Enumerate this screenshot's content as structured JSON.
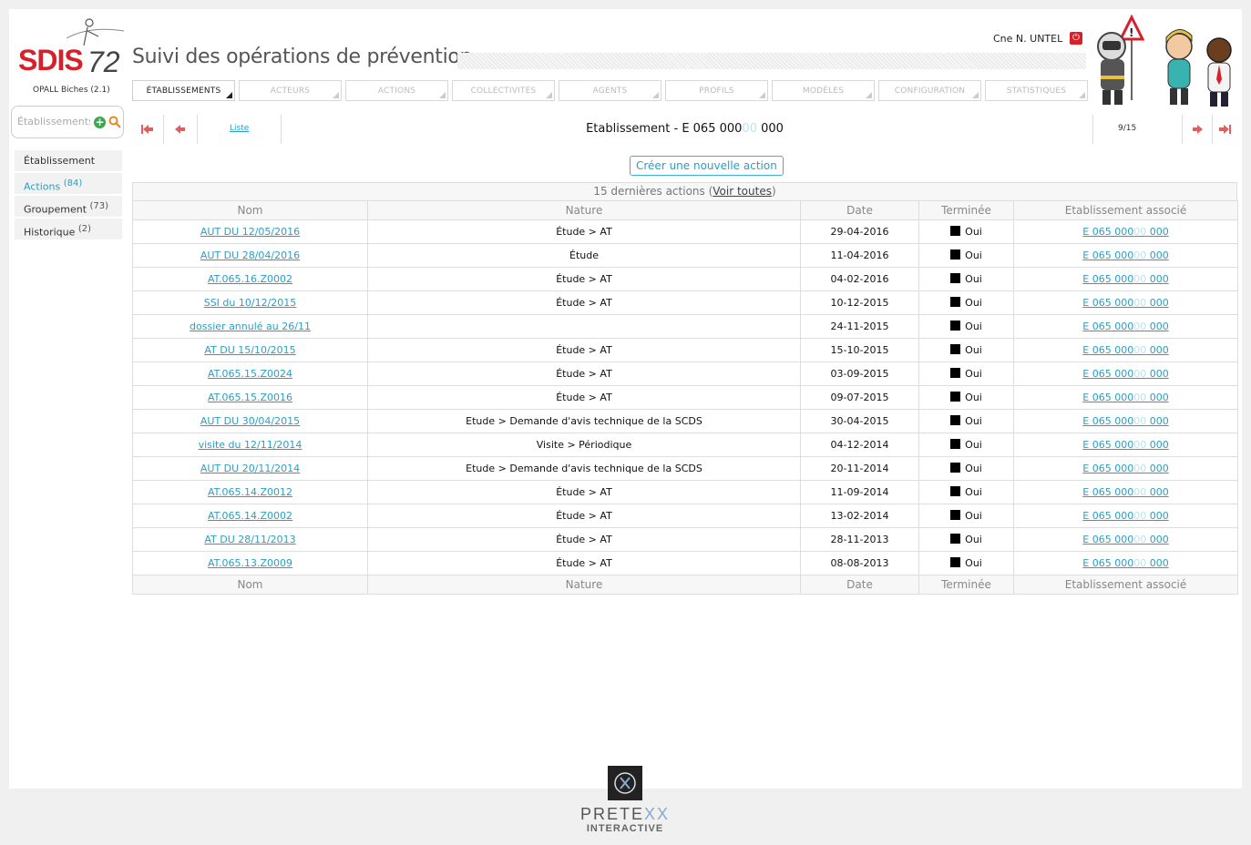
{
  "brand": {
    "logo_text": "SDIS",
    "logo_number": "72",
    "version": "OPALL Biches (2.1)"
  },
  "app_title": "Suivi des opérations de prévention",
  "user": {
    "name": "Cne N. UNTEL"
  },
  "nav": {
    "tabs": [
      {
        "label": "ÉTABLISSEMENTS",
        "active": true
      },
      {
        "label": "ACTEURS"
      },
      {
        "label": "ACTIONS"
      },
      {
        "label": "COLLECTIVITÉS"
      },
      {
        "label": "AGENTS"
      },
      {
        "label": "PROFILS"
      },
      {
        "label": "MODÈLES"
      },
      {
        "label": "CONFIGURATION"
      },
      {
        "label": "STATISTIQUES"
      }
    ]
  },
  "search": {
    "placeholder": "Établissements"
  },
  "sidebar": {
    "items": [
      {
        "label": "Établissement",
        "count": ""
      },
      {
        "label": "Actions",
        "count": "(84)",
        "active": true
      },
      {
        "label": "Groupement",
        "count": "(73)"
      },
      {
        "label": "Historique",
        "count": "(2)"
      }
    ]
  },
  "record": {
    "list_label": "Liste",
    "title_prefix": "Etablissement - E 065 000",
    "title_masked": "00",
    "title_suffix": " 000",
    "position": "9/15"
  },
  "create_button": "Créer une nouvelle action",
  "table": {
    "caption_prefix": "15 dernières actions (",
    "caption_link": "Voir toutes",
    "caption_suffix": ")",
    "columns": [
      "Nom",
      "Nature",
      "Date",
      "Terminée",
      "Etablissement associé"
    ],
    "rows": [
      {
        "nom": "AUT DU 12/05/2016 ",
        "nature": "Étude > AT",
        "date": "29-04-2016",
        "terminee": "Oui",
        "etab": "E 065 000",
        "etab_mask": "00",
        "etab_suffix": " 000"
      },
      {
        "nom": "AUT DU 28/04/2016 ",
        "nature": "Étude",
        "date": "11-04-2016",
        "terminee": "Oui",
        "etab": "E 065 000",
        "etab_mask": "00",
        "etab_suffix": " 000"
      },
      {
        "nom": "AT.065.16.Z0002 ",
        "nature": "Étude > AT",
        "date": "04-02-2016",
        "terminee": "Oui",
        "etab": "E 065 000",
        "etab_mask": "00",
        "etab_suffix": " 000"
      },
      {
        "nom": "SSI du 10/12/2015 ",
        "nature": "Étude > AT",
        "date": "10-12-2015",
        "terminee": "Oui",
        "etab": "E 065 000",
        "etab_mask": "00",
        "etab_suffix": " 000"
      },
      {
        "nom": "dossier annulé au 26/11 ",
        "nature": "",
        "date": "24-11-2015",
        "terminee": "Oui",
        "etab": "E 065 000",
        "etab_mask": "00",
        "etab_suffix": " 000"
      },
      {
        "nom": "AT DU 15/10/2015 ",
        "nature": "Étude > AT",
        "date": "15-10-2015",
        "terminee": "Oui",
        "etab": "E 065 000",
        "etab_mask": "00",
        "etab_suffix": " 000"
      },
      {
        "nom": "AT.065.15.Z0024 ",
        "nature": "Étude > AT",
        "date": "03-09-2015",
        "terminee": "Oui",
        "etab": "E 065 000",
        "etab_mask": "00",
        "etab_suffix": " 000"
      },
      {
        "nom": "AT.065.15.Z0016 ",
        "nature": "Étude > AT",
        "date": "09-07-2015",
        "terminee": "Oui",
        "etab": "E 065 000",
        "etab_mask": "00",
        "etab_suffix": " 000"
      },
      {
        "nom": "AUT DU 30/04/2015 ",
        "nature": "Etude > Demande d'avis technique de la SCDS",
        "date": "30-04-2015",
        "terminee": "Oui",
        "etab": "E 065 000",
        "etab_mask": "00",
        "etab_suffix": " 000"
      },
      {
        "nom": "visite du 12/11/2014 ",
        "nature": "Visite > Périodique",
        "date": "04-12-2014",
        "terminee": "Oui",
        "etab": "E 065 000",
        "etab_mask": "00",
        "etab_suffix": " 000"
      },
      {
        "nom": "AUT DU 20/11/2014 ",
        "nature": "Etude > Demande d'avis technique de la SCDS",
        "date": "20-11-2014",
        "terminee": "Oui",
        "etab": "E 065 000",
        "etab_mask": "00",
        "etab_suffix": " 000"
      },
      {
        "nom": "AT.065.14.Z0012 ",
        "nature": "Étude > AT",
        "date": "11-09-2014",
        "terminee": "Oui",
        "etab": "E 065 000",
        "etab_mask": "00",
        "etab_suffix": " 000"
      },
      {
        "nom": "AT.065.14.Z0002 ",
        "nature": "Étude > AT",
        "date": "13-02-2014",
        "terminee": "Oui",
        "etab": "E 065 000",
        "etab_mask": "00",
        "etab_suffix": " 000"
      },
      {
        "nom": "AT DU 28/11/2013 ",
        "nature": "Étude > AT",
        "date": "28-11-2013",
        "terminee": "Oui",
        "etab": "E 065 000",
        "etab_mask": "00",
        "etab_suffix": " 000"
      },
      {
        "nom": "AT.065.13.Z0009 ",
        "nature": "Étude > AT",
        "date": "08-08-2013",
        "terminee": "Oui",
        "etab": "E 065 000",
        "etab_mask": "00",
        "etab_suffix": " 000"
      }
    ]
  },
  "footer": {
    "brand_main": "PRETE",
    "brand_xx": "XX",
    "brand_sub": "INTERACTIVE"
  },
  "colors": {
    "accent": "#2a9fc3",
    "brand_red": "#d8202a"
  }
}
